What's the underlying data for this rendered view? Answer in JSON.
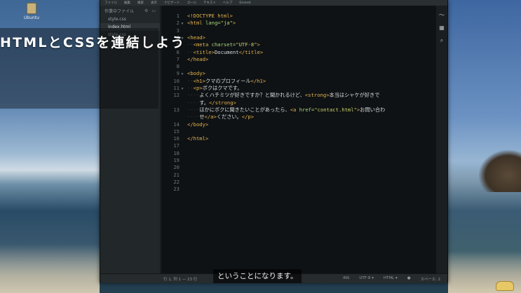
{
  "desktop": {
    "icon_label": "Ubuntu"
  },
  "menubar": [
    "ファイル",
    "編集",
    "検索",
    "表示",
    "ナビゲート",
    "ゴール",
    "テキスト",
    "ヘルプ",
    "Emmet"
  ],
  "sidebar": {
    "heading": "作業中ファイル",
    "files": [
      {
        "name": "style.css",
        "active": false
      },
      {
        "name": "index.html",
        "active": true
      },
      {
        "name": "style.css",
        "active": false
      }
    ]
  },
  "overlay_title": "HTMLとCSSを連結しよう",
  "subtitle": "ということになります。",
  "code_lines": [
    {
      "n": "1",
      "fold": "",
      "html": "<span class='tag'>&lt;!DOCTYPE html&gt;</span>"
    },
    {
      "n": "2",
      "fold": "▼",
      "html": "<span class='tag'>&lt;html</span> <span class='attr'>lang=</span><span class='str'>\"ja\"</span><span class='tag'>&gt;</span>"
    },
    {
      "n": "3",
      "fold": "",
      "html": ""
    },
    {
      "n": "4",
      "fold": "▼",
      "html": "<span class='tag'>&lt;head&gt;</span>"
    },
    {
      "n": "5",
      "fold": "",
      "html": "<span class='guide'>··</span><span class='tag'>&lt;meta</span> <span class='attr'>charset=</span><span class='str'>\"UTF-8\"</span><span class='tag'>&gt;</span>"
    },
    {
      "n": "6",
      "fold": "",
      "html": "<span class='guide'>··</span><span class='tag'>&lt;title&gt;</span>Document<span class='tag'>&lt;/title&gt;</span>"
    },
    {
      "n": "7",
      "fold": "",
      "html": "<span class='tag'>&lt;/head&gt;</span>"
    },
    {
      "n": "8",
      "fold": "",
      "html": ""
    },
    {
      "n": "9",
      "fold": "▼",
      "html": "<span class='tag'>&lt;body&gt;</span>"
    },
    {
      "n": "10",
      "fold": "",
      "html": "<span class='guide'>··</span><span class='tag'>&lt;h1&gt;</span>クマのプロフィール<span class='tag'>&lt;/h1&gt;</span>"
    },
    {
      "n": "11",
      "fold": "▼",
      "html": "<span class='guide'>··</span><span class='tag'>&lt;p&gt;</span>ボクはクマです。"
    },
    {
      "n": "12",
      "fold": "",
      "html": "<span class='guide'>····</span>よくハチミツが好きですか？と聞かれるけど、<span class='tag'>&lt;strong&gt;</span>本当はシャケが好きで"
    },
    {
      "n": "",
      "fold": "",
      "html": "<span class='guide'>····</span>す。<span class='tag'>&lt;/strong&gt;</span>"
    },
    {
      "n": "13",
      "fold": "",
      "html": "<span class='guide'>····</span>ほかにボクに聞きたいことがあったら、<span class='tag'>&lt;a</span> <span class='attr'>href=</span><span class='str'>\"contact.html\"</span><span class='tag'>&gt;</span>お問い合わ"
    },
    {
      "n": "",
      "fold": "",
      "html": "<span class='guide'>····</span>せ<span class='tag'>&lt;/a&gt;</span>ください。<span class='tag'>&lt;/p&gt;</span>"
    },
    {
      "n": "14",
      "fold": "",
      "html": "<span class='tag'>&lt;/body&gt;</span>"
    },
    {
      "n": "15",
      "fold": "",
      "html": ""
    },
    {
      "n": "16",
      "fold": "",
      "html": "<span class='tag'>&lt;/html&gt;</span>"
    },
    {
      "n": "17",
      "fold": "",
      "html": ""
    },
    {
      "n": "18",
      "fold": "",
      "html": ""
    },
    {
      "n": "19",
      "fold": "",
      "html": ""
    },
    {
      "n": "20",
      "fold": "",
      "html": ""
    },
    {
      "n": "21",
      "fold": "",
      "html": ""
    },
    {
      "n": "22",
      "fold": "",
      "html": ""
    },
    {
      "n": "23",
      "fold": "",
      "html": ""
    }
  ],
  "statusbar": {
    "position": "行 1, 列 1 — 23 行",
    "ins": "INS",
    "encoding": "UTF-8 ▾",
    "language": "HTML ▾",
    "spaces": "スペース: 2"
  },
  "rail_icons": [
    "live-preview-icon",
    "extension-manager-icon",
    "search-icon"
  ]
}
